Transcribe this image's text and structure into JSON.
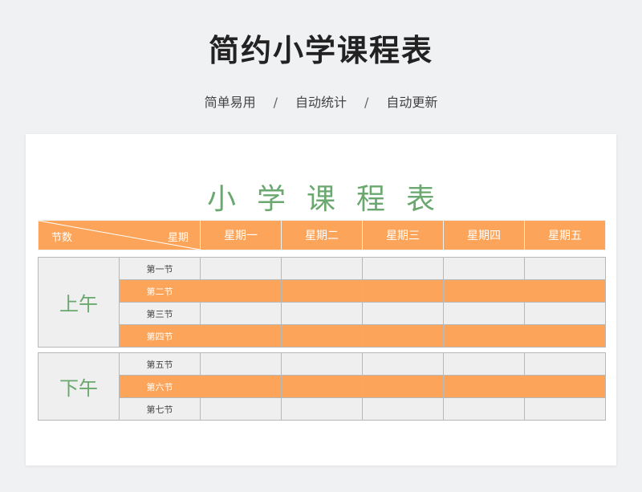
{
  "header": {
    "title": "简约小学课程表",
    "tags": [
      "简单易用",
      "自动统计",
      "自动更新"
    ],
    "separator": "/"
  },
  "sheet": {
    "title": "小学课程表",
    "corner_left": "节数",
    "corner_right": "星期",
    "days": [
      "星期一",
      "星期二",
      "星期三",
      "星期四",
      "星期五"
    ],
    "morning": {
      "label": "上午",
      "lessons": [
        "第一节",
        "第二节",
        "第三节",
        "第四节"
      ]
    },
    "afternoon": {
      "label": "下午",
      "lessons": [
        "第五节",
        "第六节",
        "第七节"
      ]
    }
  },
  "colors": {
    "accent_orange": "#fca55a",
    "accent_green": "#6aa86f",
    "row_gray": "#efefef"
  }
}
